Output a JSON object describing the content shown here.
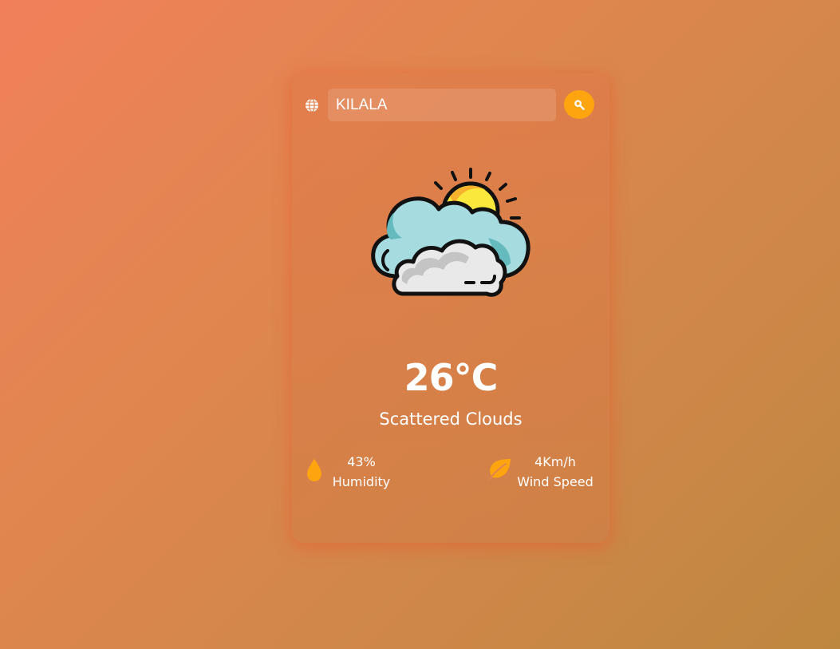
{
  "search": {
    "value": "KILALA",
    "globe_icon": "globe-icon",
    "button_icon": "search-icon"
  },
  "weather": {
    "icon": "sun-behind-clouds-icon",
    "temperature": "26°C",
    "description": "Scattered Clouds"
  },
  "stats": {
    "humidity": {
      "value": "43%",
      "label": "Humidity",
      "icon": "water-drop-icon"
    },
    "wind": {
      "value": "4Km/h",
      "label": "Wind Speed",
      "icon": "leaf-icon"
    }
  },
  "colors": {
    "accent": "#fda40f",
    "text": "#ffffff"
  }
}
